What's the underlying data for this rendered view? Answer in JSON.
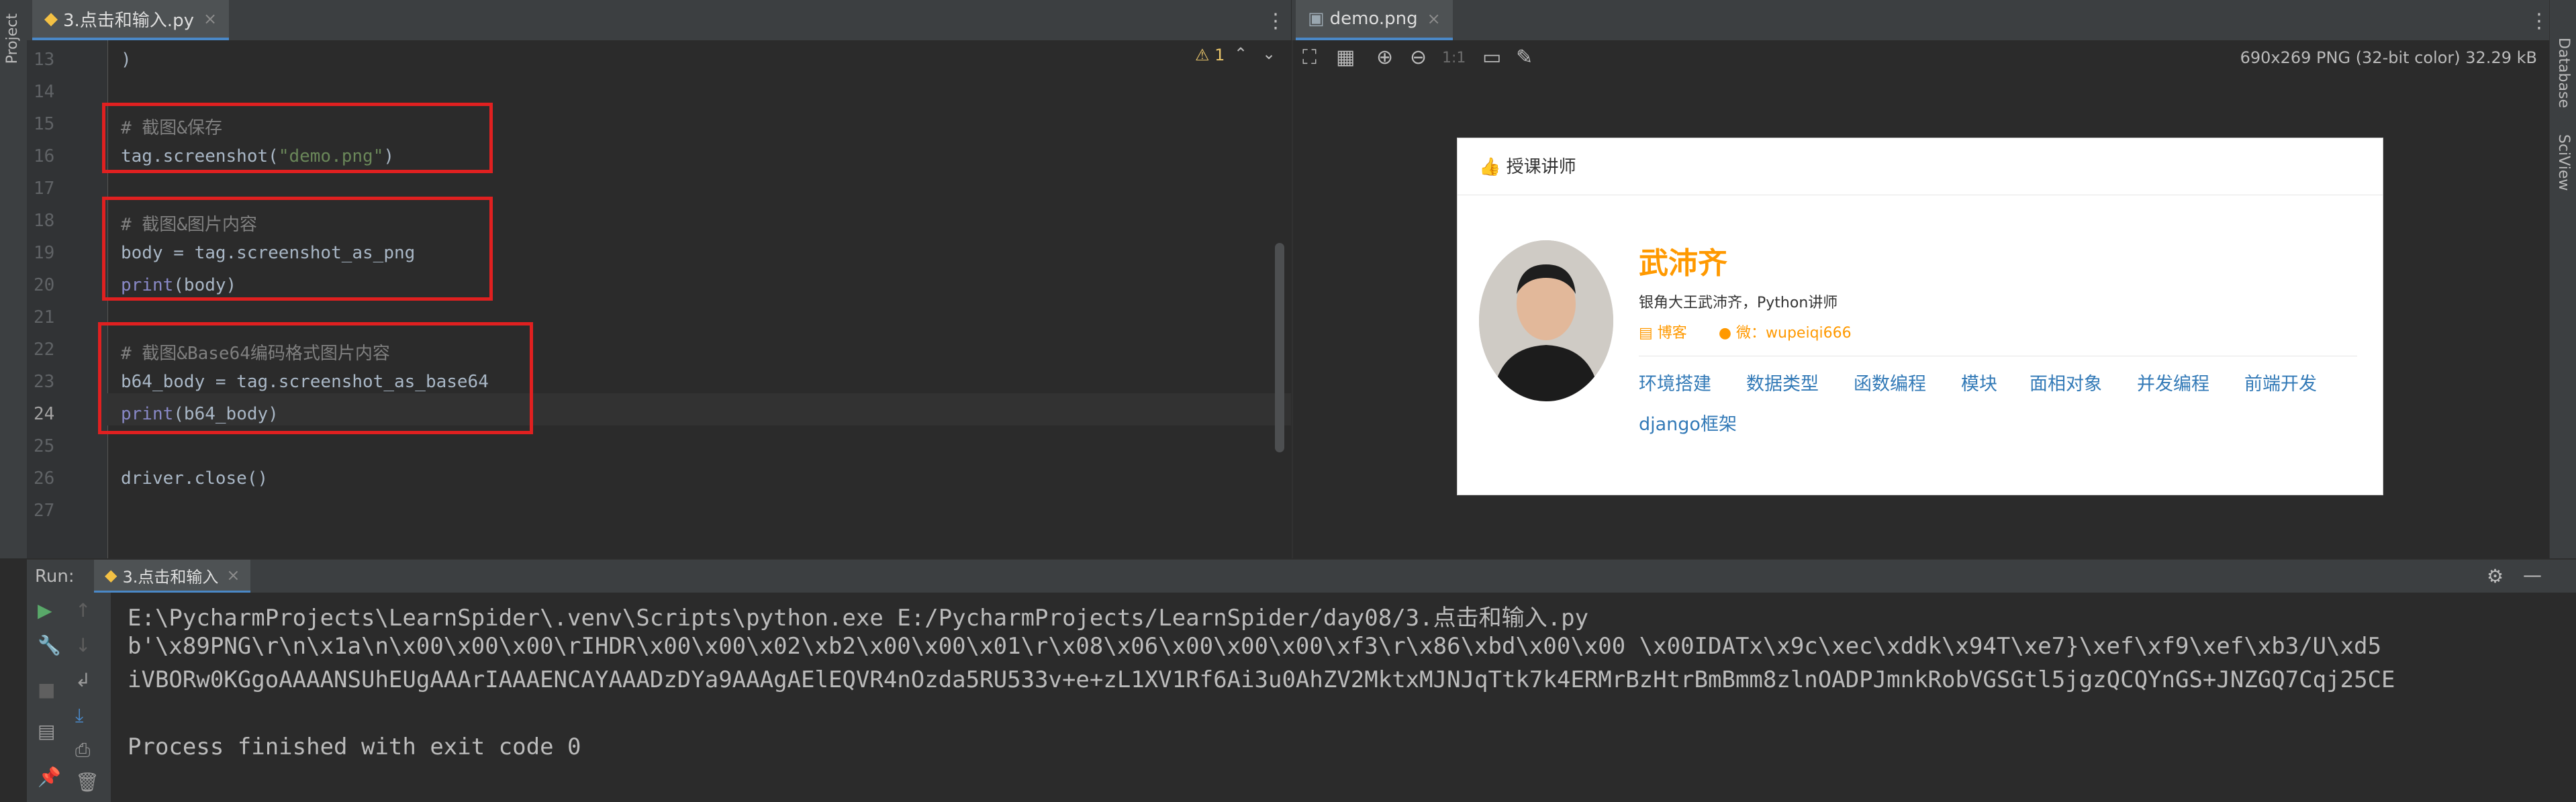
{
  "project_strip": {
    "label": "Project"
  },
  "right_strip": {
    "database_label": "Database",
    "sciview_label": "SciView"
  },
  "editor_tab": {
    "label": "3.点击和输入.py",
    "close": "×"
  },
  "editor_status": {
    "warning_count": "1"
  },
  "code_lines": [
    {
      "num": "13",
      "text": ")"
    },
    {
      "num": "14",
      "text": ""
    },
    {
      "num": "15",
      "comment": "# 截图&保存"
    },
    {
      "num": "16",
      "pre": "tag.screenshot(",
      "str": "\"demo.png\"",
      "post": ")"
    },
    {
      "num": "17",
      "text": ""
    },
    {
      "num": "18",
      "comment": "# 截图&图片内容"
    },
    {
      "num": "19",
      "text": "body = tag.screenshot_as_png"
    },
    {
      "num": "20",
      "kw": "print",
      "post": "(body)"
    },
    {
      "num": "21",
      "text": ""
    },
    {
      "num": "22",
      "comment": "# 截图&Base64编码格式图片内容"
    },
    {
      "num": "23",
      "text": "b64_body = tag.screenshot_as_base64"
    },
    {
      "num": "24",
      "kw": "print",
      "post": "(b64_body)"
    },
    {
      "num": "25",
      "text": ""
    },
    {
      "num": "26",
      "text": "driver.close()"
    },
    {
      "num": "27",
      "text": ""
    }
  ],
  "viewer_tab": {
    "label": "demo.png",
    "close": "×"
  },
  "viewer_toolbar": {
    "actual_size": "1:1"
  },
  "image_info": "690x269 PNG (32-bit color) 32.29 kB",
  "demo": {
    "header": "授课讲师",
    "name": "武沛齐",
    "desc": "银角大王武沛齐，Python讲师",
    "blog": "博客",
    "wechat": "微：wupeiqi666",
    "topics": [
      "环境搭建",
      "数据类型",
      "函数编程",
      "模块",
      "面相对象",
      "并发编程",
      "前端开发",
      "django框架"
    ]
  },
  "run": {
    "label": "Run:",
    "tab": "3.点击和输入",
    "close": "×",
    "output": [
      "E:\\PycharmProjects\\LearnSpider\\.venv\\Scripts\\python.exe E:/PycharmProjects/LearnSpider/day08/3.点击和输入.py",
      "b'\\x89PNG\\r\\n\\x1a\\n\\x00\\x00\\x00\\rIHDR\\x00\\x00\\x02\\xb2\\x00\\x00\\x01\\r\\x08\\x06\\x00\\x00\\x00\\xf3\\r\\x86\\xbd\\x00\\x00 \\x00IDATx\\x9c\\xec\\xddk\\x94T\\xe7}\\xef\\xf9\\xef\\xb3/U\\xd5",
      "iVBORw0KGgoAAAANSUhEUgAAArIAAAENCAYAAADzDYa9AAAgAElEQVR4nOzda5RU533v+e+zL1XV1Rf6Ai3u0AhZV2MktxMJNJqTtk7k4ERMrBzHtrBmBmm8zlnOADPJmnkRobVGSGtl5jgzQCQYnGS+JNZGQ7Cqj25CE",
      "",
      "Process finished with exit code 0"
    ]
  },
  "colors": {
    "highlight_box": "#e02020",
    "accent": "#4a88c7",
    "name_orange": "#ff9900",
    "topic_blue": "#337ab7"
  }
}
